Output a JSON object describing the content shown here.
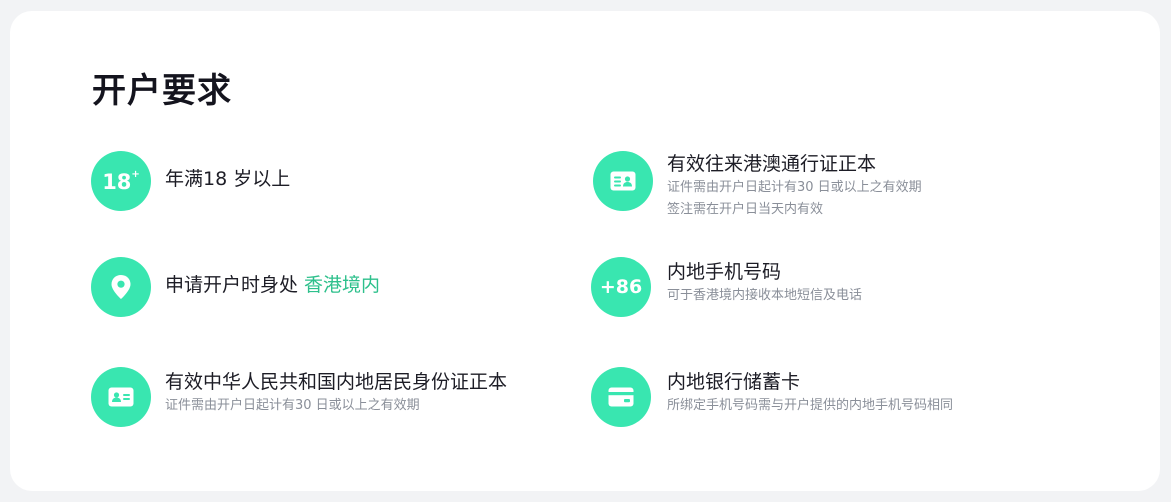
{
  "page": {
    "title": "开户要求"
  },
  "requirements": {
    "age": {
      "badge_number": "18",
      "badge_sup": "+",
      "main": "年满18 岁以上"
    },
    "location": {
      "main_prefix": "申请开户时身处 ",
      "main_highlight": "香港境内",
      "icon": "location-pin-icon"
    },
    "mainland_id": {
      "main": "有效中华人民共和国内地居民身份证正本",
      "sub": "证件需由开户日起计有30 日或以上之有效期",
      "icon": "id-card-icon"
    },
    "hk_permit": {
      "main": "有效往来港澳通行证正本",
      "sub1": "证件需由开户日起计有30 日或以上之有效期",
      "sub2": "签注需在开户日当天内有效",
      "icon": "permit-card-icon"
    },
    "phone": {
      "badge": "+86",
      "main": "内地手机号码",
      "sub": "可于香港境内接收本地短信及电话"
    },
    "bank_card": {
      "main": "内地银行储蓄卡",
      "sub": "所绑定手机号码需与开户提供的内地手机号码相同",
      "icon": "bank-card-icon"
    }
  },
  "colors": {
    "accent": "#39e6b0",
    "highlight": "#2ec08c"
  }
}
